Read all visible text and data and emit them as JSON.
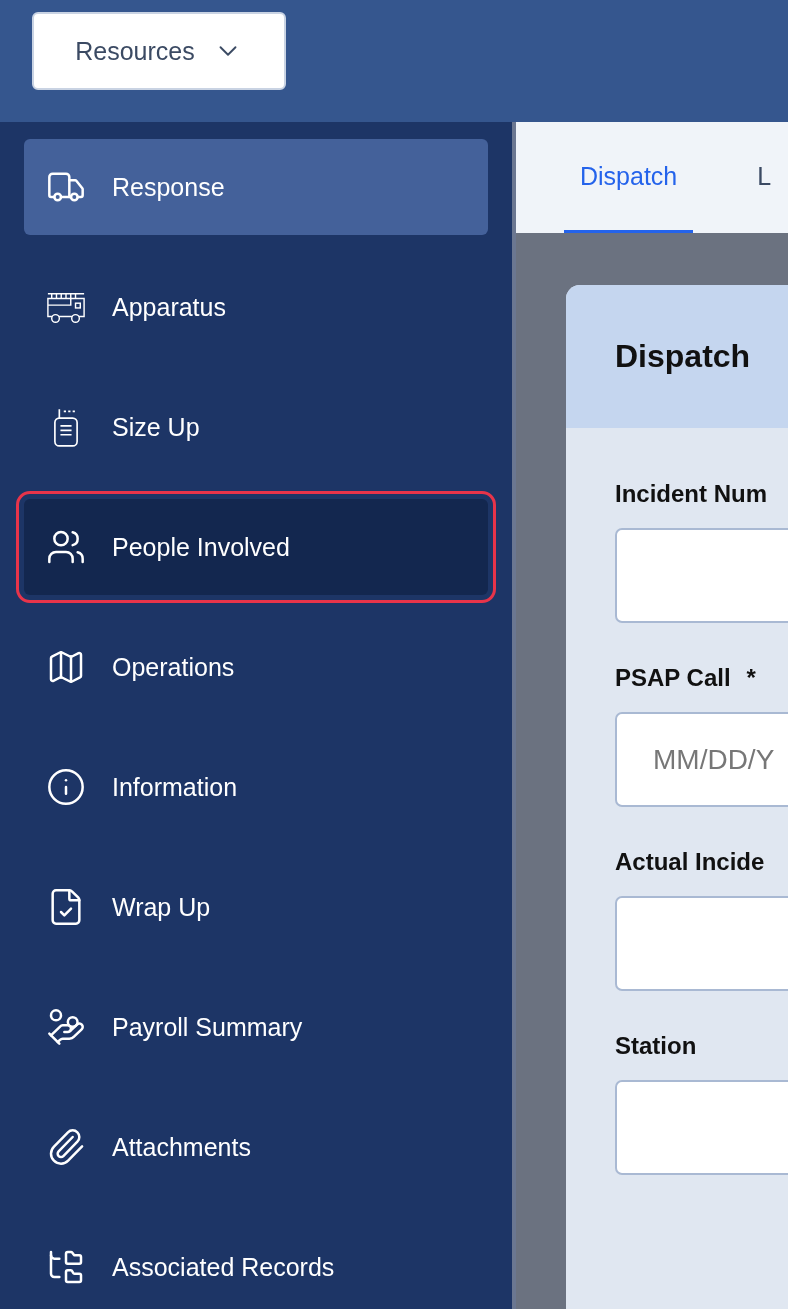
{
  "header": {
    "resources_button": "Resources"
  },
  "sidebar": {
    "items": [
      {
        "label": "Response",
        "selected": true,
        "highlighted": false
      },
      {
        "label": "Apparatus",
        "selected": false,
        "highlighted": false
      },
      {
        "label": "Size Up",
        "selected": false,
        "highlighted": false
      },
      {
        "label": "People Involved",
        "selected": false,
        "highlighted": true
      },
      {
        "label": "Operations",
        "selected": false,
        "highlighted": false
      },
      {
        "label": "Information",
        "selected": false,
        "highlighted": false
      },
      {
        "label": "Wrap Up",
        "selected": false,
        "highlighted": false
      },
      {
        "label": "Payroll Summary",
        "selected": false,
        "highlighted": false
      },
      {
        "label": "Attachments",
        "selected": false,
        "highlighted": false
      },
      {
        "label": "Associated Records",
        "selected": false,
        "highlighted": false
      }
    ]
  },
  "tabs": [
    {
      "label": "Dispatch",
      "selected": true
    },
    {
      "label": "L",
      "selected": false
    }
  ],
  "card": {
    "title": "Dispatch",
    "fields": [
      {
        "label": "Incident Num"
      },
      {
        "label": "PSAP Call",
        "required_mark": "*",
        "placeholder": "MM/DD/Y"
      },
      {
        "label": "Actual Incide"
      },
      {
        "label": "Station"
      }
    ]
  }
}
